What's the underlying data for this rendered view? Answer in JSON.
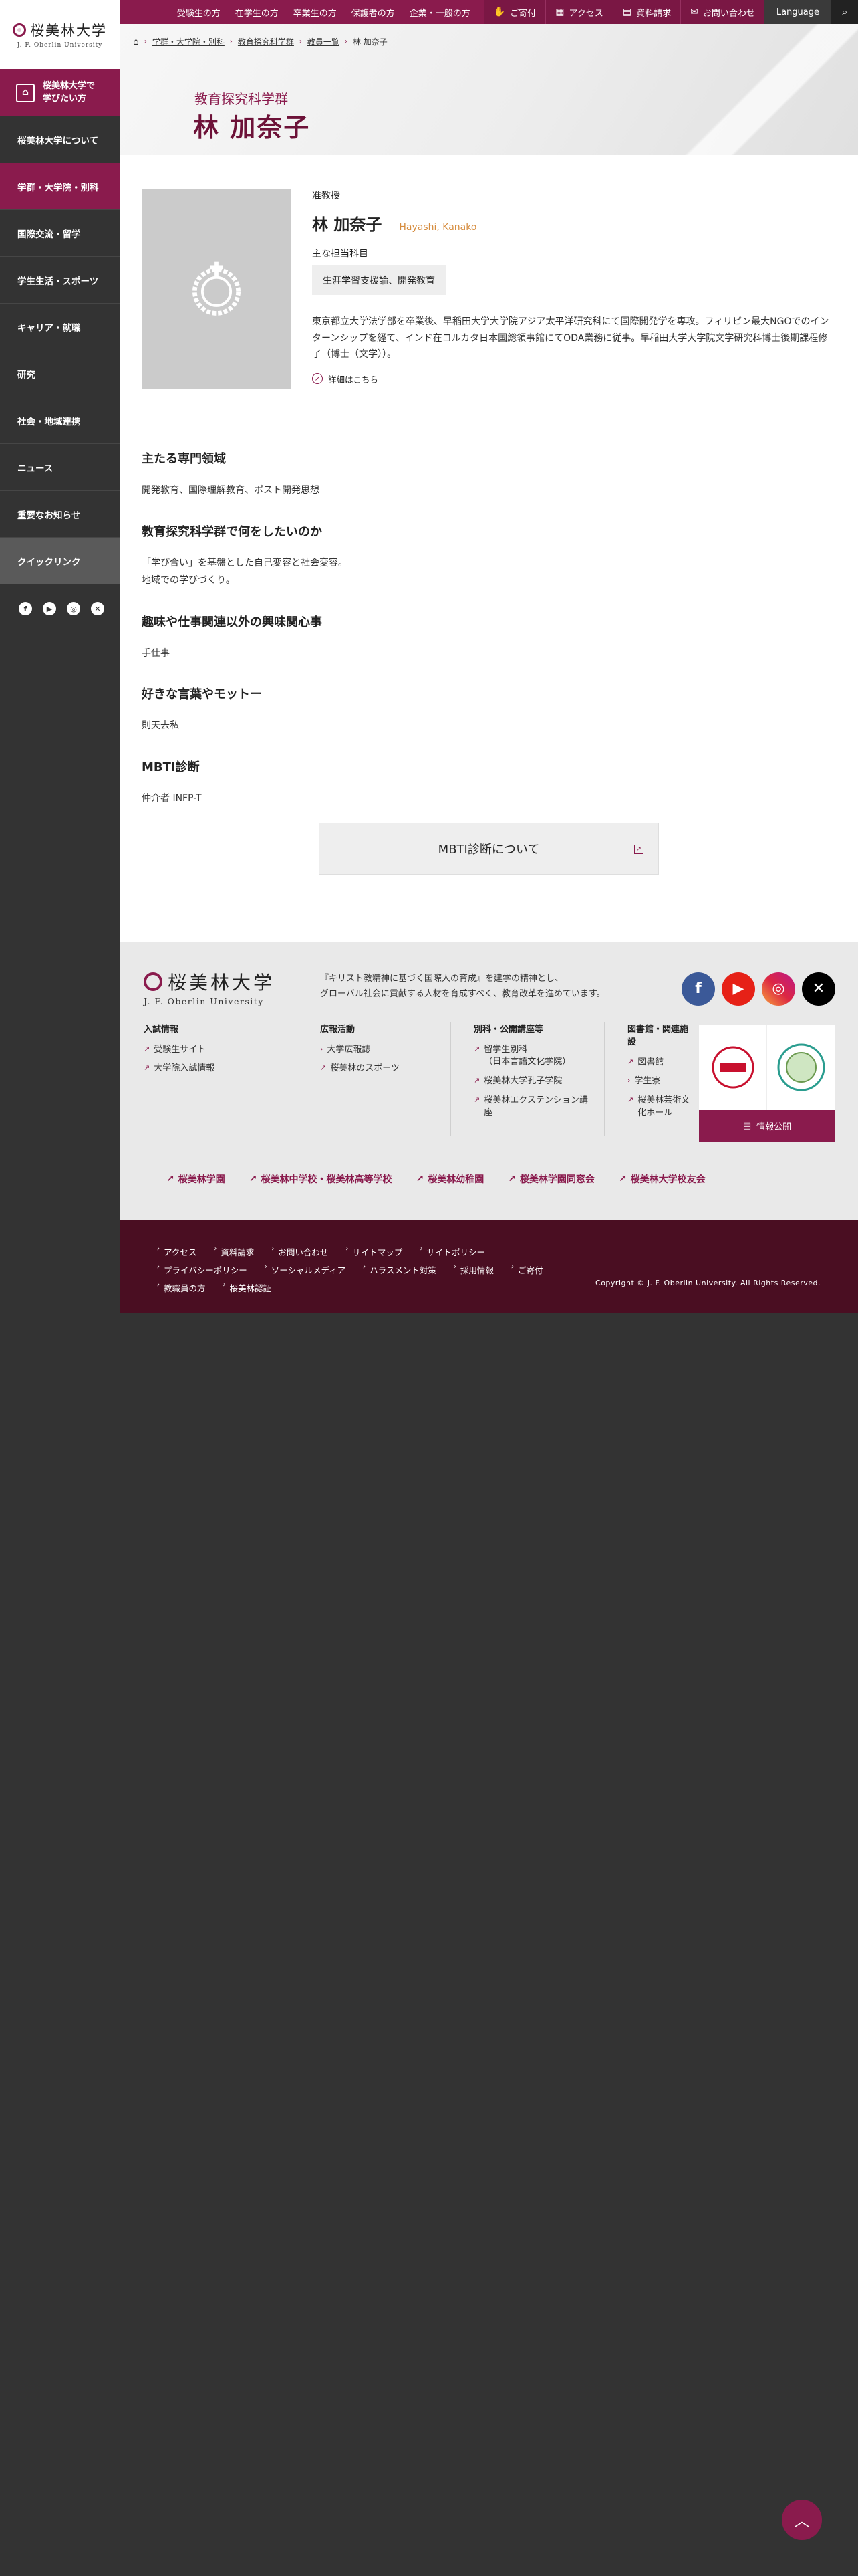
{
  "logo": {
    "jp": "桜美林大学",
    "en": "J. F. Oberlin University"
  },
  "sidebar": {
    "feature": "桜美林大学で\n学びたい方",
    "items": [
      {
        "label": "桜美林大学について"
      },
      {
        "label": "学群・大学院・別科"
      },
      {
        "label": "国際交流・留学"
      },
      {
        "label": "学生生活・スポーツ"
      },
      {
        "label": "キャリア・就職"
      },
      {
        "label": "研究"
      },
      {
        "label": "社会・地域連携"
      },
      {
        "label": "ニュース"
      },
      {
        "label": "重要なお知らせ"
      },
      {
        "label": "クイックリンク"
      }
    ]
  },
  "topnav": {
    "audience": [
      "受験生の方",
      "在学生の方",
      "卒業生の方",
      "保護者の方",
      "企業・一般の方"
    ],
    "donate": "ご寄付",
    "access": "アクセス",
    "request": "資料請求",
    "contact": "お問い合わせ",
    "language": "Language"
  },
  "breadcrumb": {
    "level1": "学群・大学院・別科",
    "level2": "教育探究科学群",
    "level3": "教員一覧",
    "current": "林 加奈子"
  },
  "hero": {
    "category": "教育探究科学群",
    "title": "林 加奈子"
  },
  "profile": {
    "rank": "准教授",
    "name": "林 加奈子",
    "roman": "Hayashi, Kanako",
    "subjects_label": "主な担当科目",
    "subjects": "生涯学習支援論、開発教育",
    "bio": "東京都立大学法学部を卒業後、早稲田大学大学院アジア太平洋研究科にて国際開発学を専攻。フィリピン最大NGOでのインターンシップを経て、インド在コルカタ日本国総領事館にてODA業務に従事。早稲田大学大学院文学研究科博士後期課程修了（博士（文学））。",
    "detail_link": "詳細はこちら"
  },
  "sections": [
    {
      "title": "主たる専門領域",
      "body": "開発教育、国際理解教育、ポスト開発思想"
    },
    {
      "title": "教育探究科学群で何をしたいのか",
      "body": "「学び合い」を基盤とした自己変容と社会変容。\n地域での学びづくり。"
    },
    {
      "title": "趣味や仕事関連以外の興味関心事",
      "body": "手仕事"
    },
    {
      "title": "好きな言葉やモットー",
      "body": "則天去私"
    },
    {
      "title": "MBTI診断",
      "body": "仲介者 INFP-T"
    }
  ],
  "mbti_button": "MBTI診断について",
  "footer": {
    "motto": "『キリスト教精神に基づく国際人の育成』を建学の精神とし、\nグローバル社会に貢献する人材を育成すべく、教育改革を進めています。",
    "columns": [
      {
        "title": "入試情報",
        "links": [
          "受験生サイト",
          "大学院入試情報"
        ]
      },
      {
        "title": "広報活動",
        "links": [
          "大学広報誌",
          "桜美林のスポーツ"
        ]
      },
      {
        "title": "別科・公開講座等",
        "links": [
          "留学生別科\n（日本言語文化学院）",
          "桜美林大学孔子学院",
          "桜美林エクステンション講座"
        ]
      },
      {
        "title": "図書館・関連施設",
        "links": [
          "図書館",
          "学生寮",
          "桜美林芸術文化ホール"
        ]
      }
    ],
    "badge_label": "情報公開",
    "group_links": [
      "桜美林学園",
      "桜美林中学校・桜美林高等学校",
      "桜美林幼稚園",
      "桜美林学園同窓会",
      "桜美林大学校友会"
    ],
    "bottom_links": [
      "アクセス",
      "資料請求",
      "お問い合わせ",
      "サイトマップ",
      "サイトポリシー",
      "プライバシーポリシー",
      "ソーシャルメディア",
      "ハラスメント対策",
      "採用情報",
      "ご寄付",
      "教職員の方",
      "桜美林認証"
    ],
    "copyright": "Copyright © J. F. Oberlin University. All Rights Reserved."
  },
  "colors": {
    "brand": "#8a1b4d",
    "brand_dark": "#4a0e22",
    "accent_roman": "#d68c3e"
  }
}
